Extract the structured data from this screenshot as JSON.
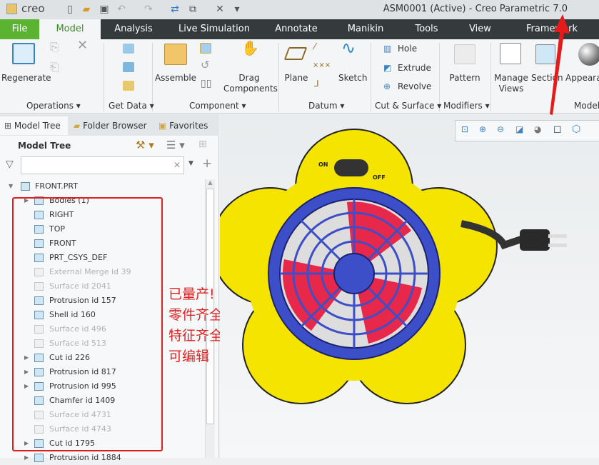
{
  "titlebar": {
    "logo": "creo",
    "title": "ASM0001 (Active) - Creo Parametric 7.0"
  },
  "tabs": [
    "File",
    "Model",
    "Analysis",
    "Live Simulation",
    "Annotate",
    "Manikin",
    "Tools",
    "View",
    "Framework"
  ],
  "ribbon": {
    "buttons": {
      "regenerate": "Regenerate",
      "assemble": "Assemble",
      "drag": "Drag Components",
      "plane": "Plane",
      "sketch": "Sketch",
      "hole": "Hole",
      "extrude": "Extrude",
      "revolve": "Revolve",
      "pattern": "Pattern",
      "manage_views": "Manage Views",
      "section": "Section",
      "appearance": "Appearance"
    },
    "groups": [
      "Operations",
      "Get Data",
      "Component",
      "Datum",
      "Cut & Surface",
      "Modifiers",
      "Model"
    ]
  },
  "panel": {
    "tabs": [
      "Model Tree",
      "Folder Browser",
      "Favorites"
    ],
    "header": "Model Tree",
    "search_value": "",
    "root": "FRONT.PRT",
    "items": [
      {
        "label": "Bodies (1)",
        "expand": true,
        "dim": false
      },
      {
        "label": "RIGHT",
        "expand": false,
        "dim": false
      },
      {
        "label": "TOP",
        "expand": false,
        "dim": false
      },
      {
        "label": "FRONT",
        "expand": false,
        "dim": false
      },
      {
        "label": "PRT_CSYS_DEF",
        "expand": false,
        "dim": false
      },
      {
        "label": "External Merge id 39",
        "expand": false,
        "dim": true
      },
      {
        "label": "Surface id 2041",
        "expand": false,
        "dim": true
      },
      {
        "label": "Protrusion id 157",
        "expand": false,
        "dim": false
      },
      {
        "label": "Shell id 160",
        "expand": false,
        "dim": false
      },
      {
        "label": "Surface id 496",
        "expand": false,
        "dim": true
      },
      {
        "label": "Surface id 513",
        "expand": false,
        "dim": true
      },
      {
        "label": "Cut id 226",
        "expand": true,
        "dim": false
      },
      {
        "label": "Protrusion id 817",
        "expand": true,
        "dim": false
      },
      {
        "label": "Protrusion id 995",
        "expand": true,
        "dim": false
      },
      {
        "label": "Chamfer id 1409",
        "expand": false,
        "dim": false
      },
      {
        "label": "Surface id 4731",
        "expand": false,
        "dim": true
      },
      {
        "label": "Surface id 4743",
        "expand": false,
        "dim": true
      },
      {
        "label": "Cut id 1795",
        "expand": true,
        "dim": false
      },
      {
        "label": "Protrusion id 1884",
        "expand": true,
        "dim": false
      }
    ]
  },
  "annotation": [
    "已量产!",
    "零件齐全",
    "特征齐全",
    "可编辑"
  ],
  "model": {
    "switch_on": "ON",
    "switch_off": "OFF"
  },
  "colors": {
    "accent_file": "#5bb431",
    "tabbar": "#353b3d",
    "annotation": "#e02020",
    "fan_yellow": "#f5e400",
    "fan_blue": "#3d4fc8",
    "fan_red": "#e8284a"
  }
}
